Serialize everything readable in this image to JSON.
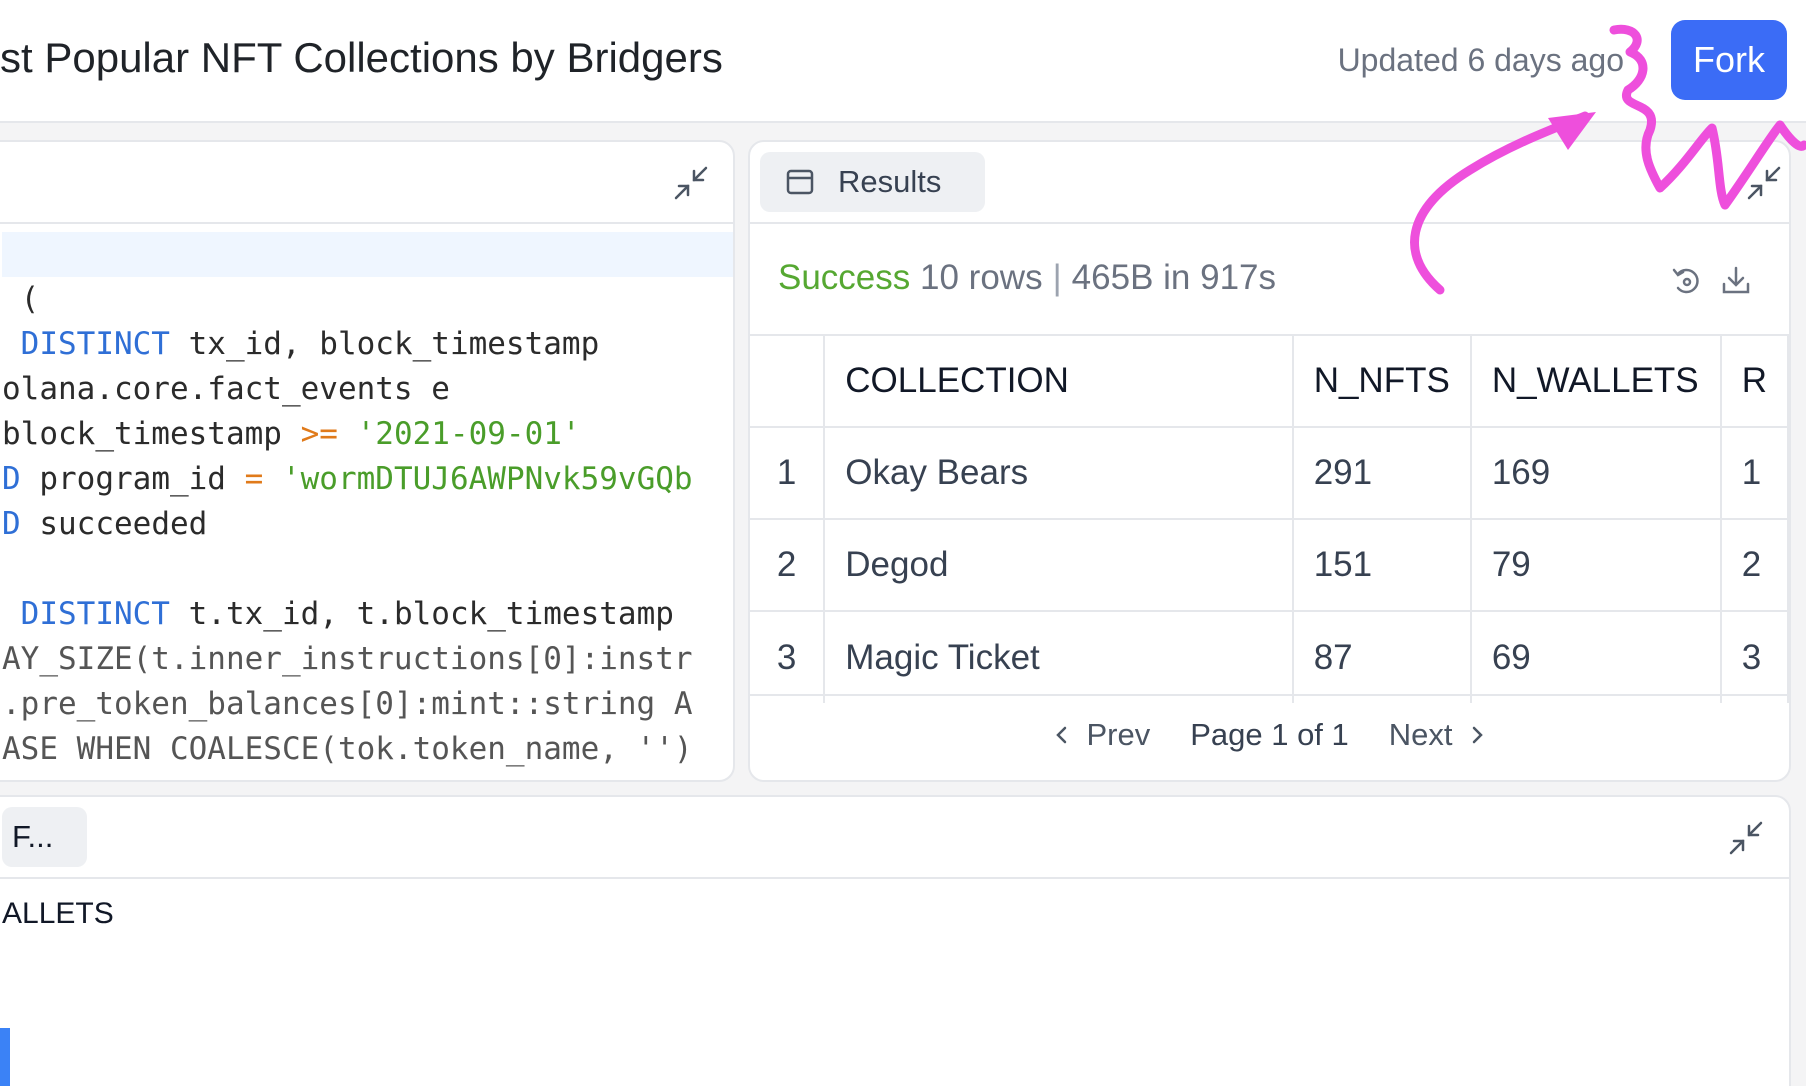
{
  "header": {
    "title": "st Popular NFT Collections by Bridgers",
    "updated": "Updated 6 days ago",
    "fork_label": "Fork"
  },
  "editor": {
    "lines": [
      {
        "segments": [
          {
            "cls": "plain",
            "text": ""
          }
        ]
      },
      {
        "segments": [
          {
            "cls": "plain",
            "text": " ("
          }
        ]
      },
      {
        "segments": [
          {
            "cls": "kw",
            "text": " DISTINCT"
          },
          {
            "cls": "plain",
            "text": " tx_id, block_timestamp"
          }
        ]
      },
      {
        "segments": [
          {
            "cls": "plain",
            "text": "olana.core.fact_events e"
          }
        ]
      },
      {
        "segments": [
          {
            "cls": "plain",
            "text": "block_timestamp "
          },
          {
            "cls": "op",
            "text": ">="
          },
          {
            "cls": "str",
            "text": " '2021-09-01'"
          }
        ]
      },
      {
        "segments": [
          {
            "cls": "kw",
            "text": "D"
          },
          {
            "cls": "plain",
            "text": " program_id "
          },
          {
            "cls": "op",
            "text": "="
          },
          {
            "cls": "str",
            "text": " 'wormDTUJ6AWPNvk59vGQb"
          }
        ]
      },
      {
        "segments": [
          {
            "cls": "kw",
            "text": "D"
          },
          {
            "cls": "plain",
            "text": " succeeded"
          }
        ]
      },
      {
        "segments": [
          {
            "cls": "plain",
            "text": ""
          }
        ]
      },
      {
        "segments": [
          {
            "cls": "kw",
            "text": " DISTINCT"
          },
          {
            "cls": "plain",
            "text": " t.tx_id, t.block_timestamp"
          }
        ]
      },
      {
        "segments": [
          {
            "cls": "dim",
            "text": "AY_SIZE(t.inner_instructions[0]:instr"
          }
        ]
      },
      {
        "segments": [
          {
            "cls": "dim",
            "text": ".pre_token_balances[0]:mint::string A"
          }
        ]
      },
      {
        "segments": [
          {
            "cls": "dim",
            "text": "ASE WHEN COALESCE(tok.token_name, '')"
          }
        ]
      }
    ]
  },
  "results": {
    "tab_label": "Results",
    "status_ok": "Success",
    "status_rows": "10 rows",
    "status_meta": "465B in 917s",
    "columns": [
      "",
      "COLLECTION",
      "N_NFTS",
      "N_WALLETS",
      "R"
    ],
    "rows": [
      [
        "1",
        "Okay Bears",
        "291",
        "169",
        "1"
      ],
      [
        "2",
        "Degod",
        "151",
        "79",
        "2"
      ],
      [
        "3",
        "Magic Ticket",
        "87",
        "69",
        "3"
      ]
    ],
    "pager": {
      "prev": "Prev",
      "page": "Page 1 of 1",
      "next": "Next"
    }
  },
  "bottom": {
    "tab_label": "F...",
    "text": "ALLETS"
  },
  "colors": {
    "accent": "#3b6cf6",
    "success": "#56a832",
    "annotation": "#ee4fdc"
  },
  "icons": [
    "collapse-icon",
    "table-icon",
    "refresh-icon",
    "download-icon",
    "chevron-left-icon",
    "chevron-right-icon"
  ]
}
